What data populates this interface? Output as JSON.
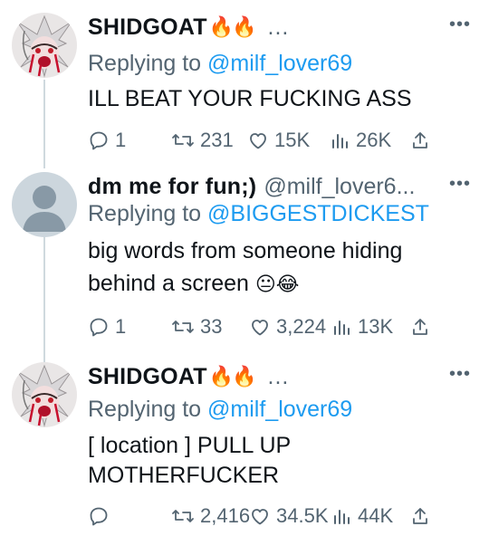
{
  "tweets": [
    {
      "name": "SHIDGOAT",
      "name_emoji": "🔥🔥",
      "handle": "...",
      "reply_prefix": "Replying to ",
      "reply_to": "@milf_lover69",
      "text": "ILL BEAT YOUR FUCKING ASS",
      "replies": "1",
      "retweets": "231",
      "likes": "15K",
      "views": "26K"
    },
    {
      "name": "dm me for fun;)",
      "handle": "@milf_lover6...",
      "reply_prefix": "Replying to ",
      "reply_to": "@BIGGESTDICKEST",
      "text_line1": "big words from someone hiding",
      "text_line2": "behind a screen",
      "text_emoji": "😐😂",
      "replies": "1",
      "retweets": "33",
      "likes": "3,224",
      "views": "13K"
    },
    {
      "name": "SHIDGOAT",
      "name_emoji": "🔥🔥",
      "handle": "...",
      "reply_prefix": "Replying to ",
      "reply_to": "@milf_lover69",
      "text_line1": "[ location ] PULL UP",
      "text_line2": "MOTHERFUCKER",
      "replies": "",
      "retweets": "2,416",
      "likes": "34.5K",
      "views": "44K"
    }
  ],
  "more_label": "•••",
  "colors": {
    "link": "#1d9bf0",
    "muted": "#536471",
    "text": "#0f1419",
    "line": "#cfd9de"
  },
  "icons": [
    "reply-icon",
    "retweet-icon",
    "like-icon",
    "views-icon",
    "share-icon",
    "more-icon"
  ]
}
